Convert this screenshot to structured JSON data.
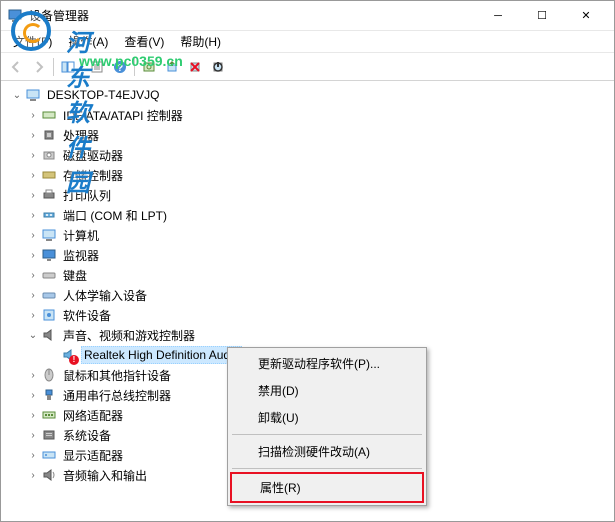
{
  "watermark": {
    "title": "河东软件园",
    "url": "www.pc0359.cn"
  },
  "window": {
    "title": "设备管理器"
  },
  "menus": {
    "file": "文件(F)",
    "action": "操作(A)",
    "view": "查看(V)",
    "help": "帮助(H)"
  },
  "tree": {
    "root": "DESKTOP-T4EJVJQ",
    "items": [
      {
        "label": "IDE ATA/ATAPI 控制器",
        "expanded": false,
        "icon": "ide"
      },
      {
        "label": "处理器",
        "expanded": false,
        "icon": "cpu"
      },
      {
        "label": "磁盘驱动器",
        "expanded": false,
        "icon": "disk"
      },
      {
        "label": "存储控制器",
        "expanded": false,
        "icon": "storage"
      },
      {
        "label": "打印队列",
        "expanded": false,
        "icon": "printer"
      },
      {
        "label": "端口 (COM 和 LPT)",
        "expanded": false,
        "icon": "port"
      },
      {
        "label": "计算机",
        "expanded": false,
        "icon": "computer"
      },
      {
        "label": "监视器",
        "expanded": false,
        "icon": "monitor"
      },
      {
        "label": "键盘",
        "expanded": false,
        "icon": "keyboard"
      },
      {
        "label": "人体学输入设备",
        "expanded": false,
        "icon": "hid"
      },
      {
        "label": "软件设备",
        "expanded": false,
        "icon": "software"
      },
      {
        "label": "声音、视频和游戏控制器",
        "expanded": true,
        "icon": "sound"
      },
      {
        "label": "鼠标和其他指针设备",
        "expanded": false,
        "icon": "mouse"
      },
      {
        "label": "通用串行总线控制器",
        "expanded": false,
        "icon": "usb"
      },
      {
        "label": "网络适配器",
        "expanded": false,
        "icon": "network"
      },
      {
        "label": "系统设备",
        "expanded": false,
        "icon": "system"
      },
      {
        "label": "显示适配器",
        "expanded": false,
        "icon": "display"
      },
      {
        "label": "音频输入和输出",
        "expanded": false,
        "icon": "audio"
      }
    ],
    "selected_child": "Realtek High Definition Audio"
  },
  "context_menu": {
    "update_driver": "更新驱动程序软件(P)...",
    "disable": "禁用(D)",
    "uninstall": "卸载(U)",
    "scan": "扫描检测硬件改动(A)",
    "properties": "属性(R)"
  }
}
